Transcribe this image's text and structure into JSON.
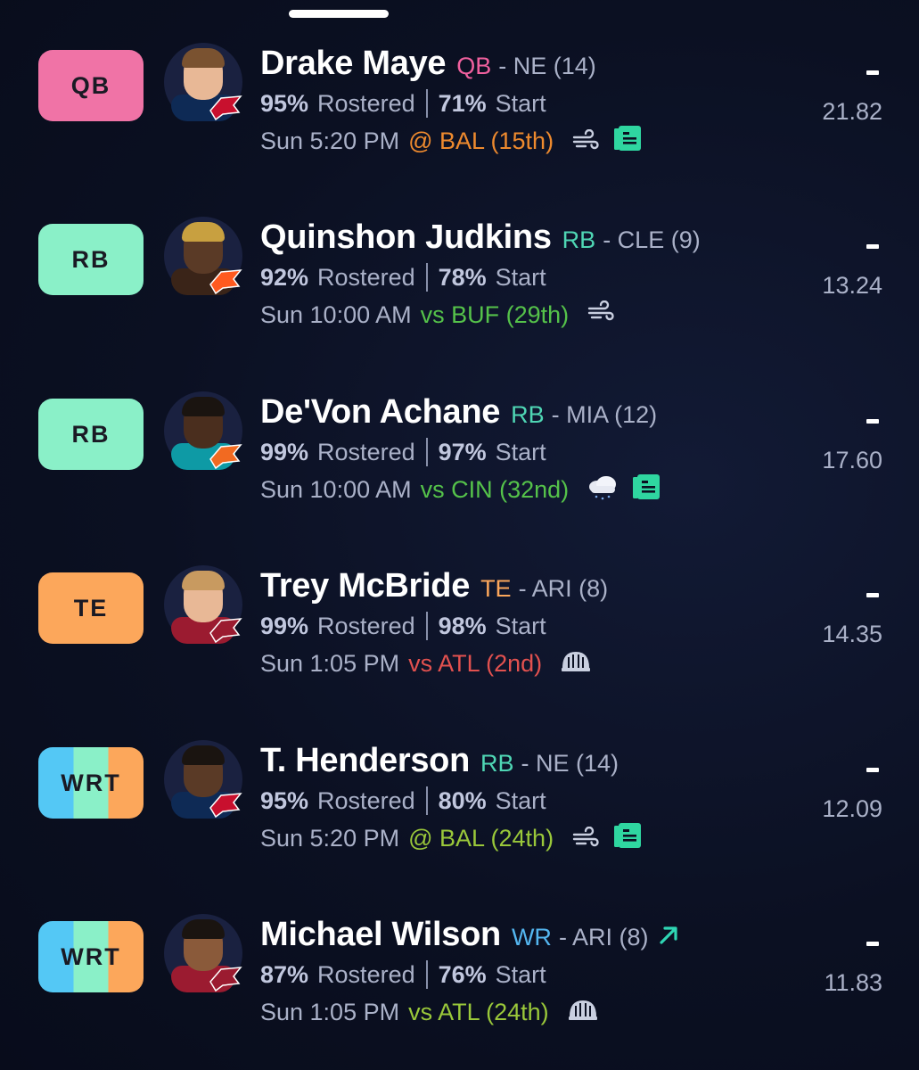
{
  "players": [
    {
      "position_badge": "QB",
      "badge_style": "qb",
      "name": "Drake Maye",
      "position": "QB",
      "team_info": "- NE (14)",
      "rostered_pct": "95%",
      "rostered_label": "Rostered",
      "start_pct": "71%",
      "start_label": "Start",
      "game_time": "Sun 5:20 PM",
      "opponent": "@ BAL (15th)",
      "opponent_color": "orange",
      "icons": [
        "wind-icon",
        "news-icon"
      ],
      "proj_dash": "-",
      "projection": "21.82",
      "avatar": {
        "skin": "#e8b896",
        "hair": "#7a5230",
        "jersey": "#0e2a55",
        "logo_color": "#c8102e",
        "logo_bg": "#0e2a55"
      }
    },
    {
      "position_badge": "RB",
      "badge_style": "rb",
      "name": "Quinshon Judkins",
      "position": "RB",
      "team_info": "- CLE (9)",
      "rostered_pct": "92%",
      "rostered_label": "Rostered",
      "start_pct": "78%",
      "start_label": "Start",
      "game_time": "Sun 10:00 AM",
      "opponent": "vs BUF (29th)",
      "opponent_color": "green",
      "icons": [
        "wind-icon"
      ],
      "proj_dash": "-",
      "projection": "13.24",
      "avatar": {
        "skin": "#5a3a26",
        "hair": "#c8a040",
        "jersey": "#3a2418",
        "logo_color": "#ff5a1f",
        "logo_bg": "#ff5a1f"
      }
    },
    {
      "position_badge": "RB",
      "badge_style": "rb",
      "name": "De'Von Achane",
      "position": "RB",
      "team_info": "- MIA (12)",
      "rostered_pct": "99%",
      "rostered_label": "Rostered",
      "start_pct": "97%",
      "start_label": "Start",
      "game_time": "Sun 10:00 AM",
      "opponent": "vs CIN (32nd)",
      "opponent_color": "green",
      "icons": [
        "rain-cloud-icon",
        "news-icon"
      ],
      "proj_dash": "-",
      "projection": "17.60",
      "avatar": {
        "skin": "#4a2e1e",
        "hair": "#1a1410",
        "jersey": "#0e9aa5",
        "logo_color": "#f26a21",
        "logo_bg": "#0e9aa5"
      }
    },
    {
      "position_badge": "TE",
      "badge_style": "te",
      "name": "Trey McBride",
      "position": "TE",
      "team_info": "- ARI (8)",
      "rostered_pct": "99%",
      "rostered_label": "Rostered",
      "start_pct": "98%",
      "start_label": "Start",
      "game_time": "Sun 1:05 PM",
      "opponent": "vs ATL (2nd)",
      "opponent_color": "red",
      "icons": [
        "dome-icon"
      ],
      "proj_dash": "-",
      "projection": "14.35",
      "avatar": {
        "skin": "#e8b896",
        "hair": "#c89a60",
        "jersey": "#9b1b30",
        "logo_color": "#9b1b30",
        "logo_bg": "#ffffff"
      }
    },
    {
      "position_badge": "WRT",
      "badge_style": "wrt",
      "name": "T. Henderson",
      "position": "RB",
      "team_info": "- NE (14)",
      "rostered_pct": "95%",
      "rostered_label": "Rostered",
      "start_pct": "80%",
      "start_label": "Start",
      "game_time": "Sun 5:20 PM",
      "opponent": "@ BAL (24th)",
      "opponent_color": "lime",
      "icons": [
        "wind-icon",
        "news-icon"
      ],
      "proj_dash": "-",
      "projection": "12.09",
      "avatar": {
        "skin": "#5a3a26",
        "hair": "#1a1410",
        "jersey": "#0e2a55",
        "logo_color": "#c8102e",
        "logo_bg": "#0e2a55"
      }
    },
    {
      "position_badge": "WRT",
      "badge_style": "wrt",
      "name": "Michael Wilson",
      "position": "WR",
      "team_info": "- ARI (8)",
      "trend": "trending-up-icon",
      "rostered_pct": "87%",
      "rostered_label": "Rostered",
      "start_pct": "76%",
      "start_label": "Start",
      "game_time": "Sun 1:05 PM",
      "opponent": "vs ATL (24th)",
      "opponent_color": "lime",
      "icons": [
        "dome-icon"
      ],
      "proj_dash": "-",
      "projection": "11.83",
      "avatar": {
        "skin": "#8a5a3a",
        "hair": "#1a1410",
        "jersey": "#9b1b30",
        "logo_color": "#9b1b30",
        "logo_bg": "#ffffff"
      }
    }
  ],
  "colors": {
    "background": "#0b1022",
    "muted_text": "#aab1c8",
    "news_icon": "#2fd6a0",
    "trend_icon": "#2fd6b4"
  }
}
